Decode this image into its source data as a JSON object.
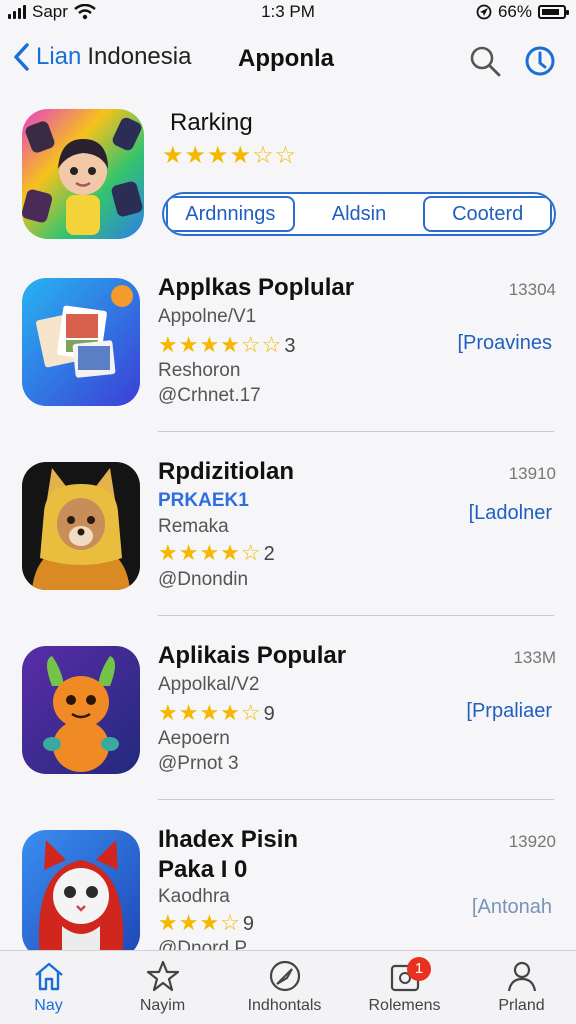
{
  "status_bar": {
    "carrier": "Sapr",
    "time": "1:3 PM",
    "battery": "66%"
  },
  "nav": {
    "back_label": "Lian",
    "back_sub": "Indonesia",
    "title": "Apponla"
  },
  "hero": {
    "title": "Rarking",
    "stars": "★★★★☆☆",
    "segments": [
      "Ardnnings",
      "Aldsin",
      "Cooterd"
    ]
  },
  "apps": [
    {
      "name": "Applkas Poplular",
      "size": "13304",
      "subtitle": "Appolne/V1",
      "stars": "★★★★☆☆",
      "rating_count": "3",
      "category": "Reshoron",
      "developer": "@Crhnet.17",
      "action": "[Proavines"
    },
    {
      "name": "Rpdizitiolan",
      "size": "13910",
      "subtitle": "PRKAEK1",
      "stars": "★★★★☆",
      "rating_count": "2",
      "category": "Remaka",
      "developer": "@Dnondin",
      "action": "[Ladolner"
    },
    {
      "name": "Aplikais Popular",
      "size": "133M",
      "subtitle": "Appolkal/V2",
      "stars": "★★★★☆",
      "rating_count": "9",
      "category": "Aepoern",
      "developer": "@Prnot 3",
      "action": "[Prpaliaer"
    },
    {
      "name": "Ihadex Pisin",
      "name2": "Paka I 0",
      "size": "13920",
      "category": "Kaodhra",
      "stars": "★★★☆",
      "rating_count": "9",
      "developer": "@Dnord P",
      "action": "[Antonah"
    }
  ],
  "tabs": [
    {
      "label": "Nay",
      "icon": "home-icon"
    },
    {
      "label": "Nayim",
      "icon": "star-icon"
    },
    {
      "label": "Indhontals",
      "icon": "compass-icon"
    },
    {
      "label": "Rolemens",
      "icon": "updates-icon",
      "badge": "1"
    },
    {
      "label": "Prland",
      "icon": "person-icon"
    }
  ],
  "colors": {
    "accent": "#1a6fd6",
    "star": "#f5b800",
    "badge": "#e8321f"
  }
}
